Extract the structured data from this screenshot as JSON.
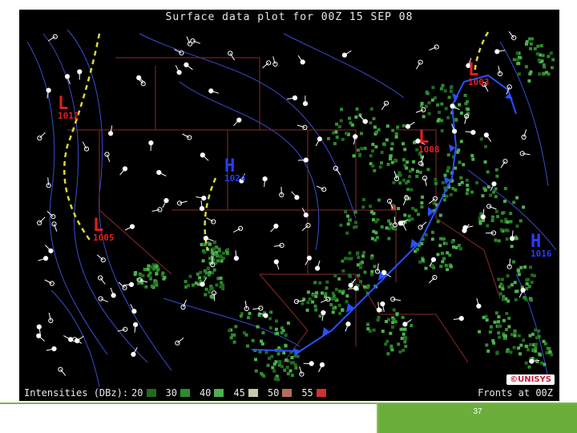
{
  "title": "Surface data plot for 00Z 15 SEP 08",
  "legend": {
    "label": "Intensities (DBz):",
    "items": [
      {
        "value": "20",
        "color": "#1f6b1f"
      },
      {
        "value": "30",
        "color": "#2e8b2e"
      },
      {
        "value": "40",
        "color": "#4fb04f"
      },
      {
        "value": "45",
        "color": "#c9c9a8"
      },
      {
        "value": "50",
        "color": "#b86a5a"
      },
      {
        "value": "55",
        "color": "#d23030"
      }
    ]
  },
  "fronts_label": "Fronts at 00Z",
  "logo_text": "©UNISYS",
  "pressure_centers": [
    {
      "type": "L",
      "value": "1012",
      "color": "#e02020"
    },
    {
      "type": "L",
      "value": "1003",
      "color": "#e02020"
    },
    {
      "type": "L",
      "value": "1008",
      "color": "#e02020"
    },
    {
      "type": "L",
      "value": "1005",
      "color": "#e02020"
    },
    {
      "type": "H",
      "value": "1024",
      "color": "#2a3cff"
    },
    {
      "type": "H",
      "value": "1016",
      "color": "#2a3cff"
    }
  ],
  "page_number": "37",
  "colors": {
    "background": "#000000",
    "isobar": "#3a4cd0",
    "state_border": "#8a2a2a",
    "cold_front": "#2a50ff",
    "trough": "#d9d93a",
    "station": "#ffffff",
    "footer_green": "#6cae3c"
  }
}
